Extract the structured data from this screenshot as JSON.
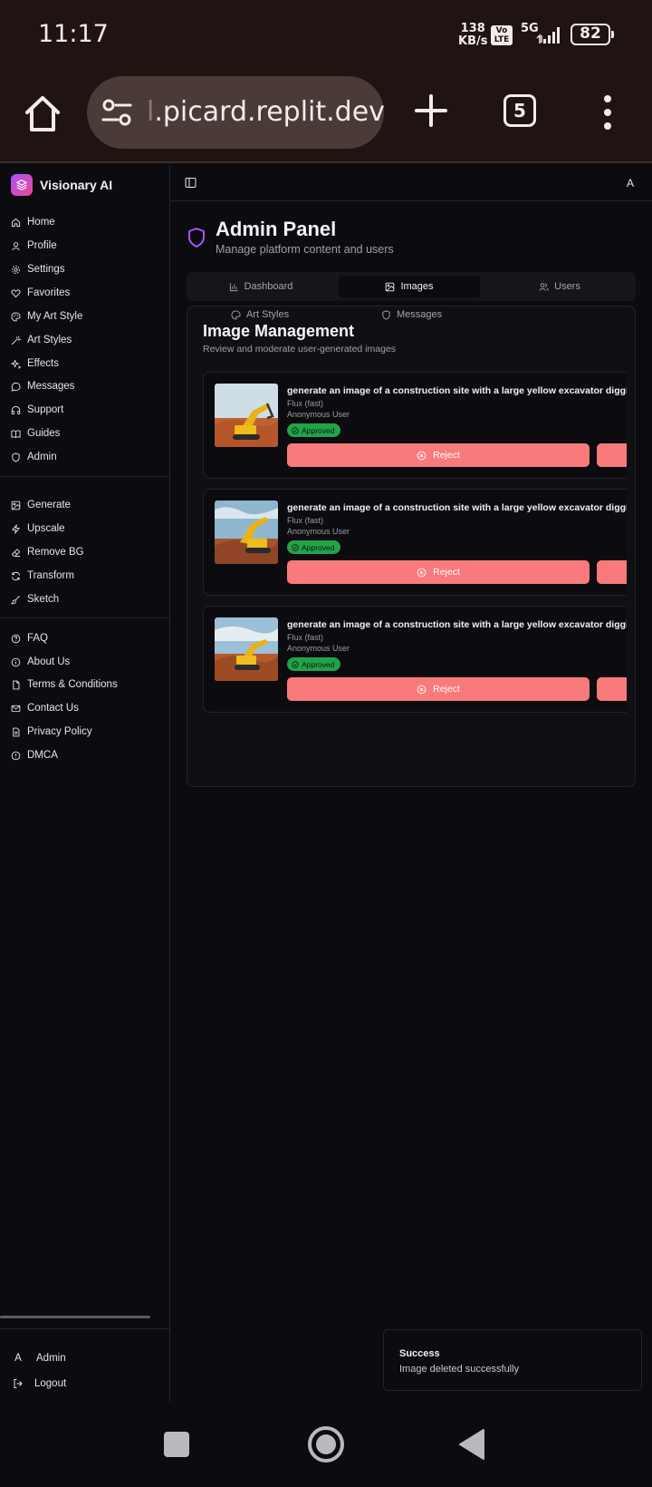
{
  "status_bar": {
    "time": "11:17",
    "net_speed_value": "138",
    "net_speed_unit": "KB/s",
    "volte": "Vo\nLTE",
    "network": "5G",
    "battery": "82"
  },
  "browser": {
    "url_prefix": "l",
    "url": ".picard.replit.dev",
    "tab_count": "5"
  },
  "brand": {
    "name": "Visionary AI"
  },
  "sidebar": {
    "group1": [
      {
        "label": "Home",
        "icon": "home-icon"
      },
      {
        "label": "Profile",
        "icon": "user-icon"
      },
      {
        "label": "Settings",
        "icon": "gear-icon"
      },
      {
        "label": "Favorites",
        "icon": "heart-icon"
      },
      {
        "label": "My Art Style",
        "icon": "palette-icon"
      },
      {
        "label": "Art Styles",
        "icon": "wand-icon"
      },
      {
        "label": "Effects",
        "icon": "sparkles-icon"
      },
      {
        "label": "Messages",
        "icon": "message-icon"
      },
      {
        "label": "Support",
        "icon": "headphones-icon"
      },
      {
        "label": "Guides",
        "icon": "book-icon"
      },
      {
        "label": "Admin",
        "icon": "shield-icon"
      }
    ],
    "group2": [
      {
        "label": "Generate",
        "icon": "image-icon"
      },
      {
        "label": "Upscale",
        "icon": "zap-icon"
      },
      {
        "label": "Remove BG",
        "icon": "eraser-icon"
      },
      {
        "label": "Transform",
        "icon": "refresh-icon"
      },
      {
        "label": "Sketch",
        "icon": "brush-icon"
      }
    ],
    "group3": [
      {
        "label": "FAQ",
        "icon": "help-icon"
      },
      {
        "label": "About Us",
        "icon": "info-icon"
      },
      {
        "label": "Terms & Conditions",
        "icon": "file-icon"
      },
      {
        "label": "Contact Us",
        "icon": "mail-icon"
      },
      {
        "label": "Privacy Policy",
        "icon": "document-icon"
      },
      {
        "label": "DMCA",
        "icon": "alert-icon"
      }
    ],
    "footer": {
      "user": "Admin",
      "user_avatar": "A",
      "logout": "Logout"
    }
  },
  "topbar": {
    "avatar": "A"
  },
  "page": {
    "title": "Admin Panel",
    "subtitle": "Manage platform content and users"
  },
  "tabs": [
    {
      "label": "Dashboard",
      "icon": "bar-chart-icon"
    },
    {
      "label": "Images",
      "icon": "image-icon",
      "active": true
    },
    {
      "label": "Users",
      "icon": "users-icon"
    },
    {
      "label": "Art Styles",
      "icon": "palette-icon"
    },
    {
      "label": "Messages",
      "icon": "shield-icon"
    }
  ],
  "card": {
    "title": "Image Management",
    "subtitle": "Review and moderate user-generated images",
    "images": [
      {
        "prompt": "generate an image of a construction site with a large yellow excavator digging",
        "model": "Flux (fast)",
        "user": "Anonymous User",
        "status": "Approved",
        "reject": "Reject"
      },
      {
        "prompt": "generate an image of a construction site with a large yellow excavator digging",
        "model": "Flux (fast)",
        "user": "Anonymous User",
        "status": "Approved",
        "reject": "Reject"
      },
      {
        "prompt": "generate an image of a construction site with a large yellow excavator digging",
        "model": "Flux (fast)",
        "user": "Anonymous User",
        "status": "Approved",
        "reject": "Reject"
      }
    ]
  },
  "toast": {
    "title": "Success",
    "message": "Image deleted successfully"
  },
  "colors": {
    "accent": "#a855f7",
    "approved": "#22a347",
    "reject": "#f87a7a",
    "background": "#0b0b10"
  }
}
